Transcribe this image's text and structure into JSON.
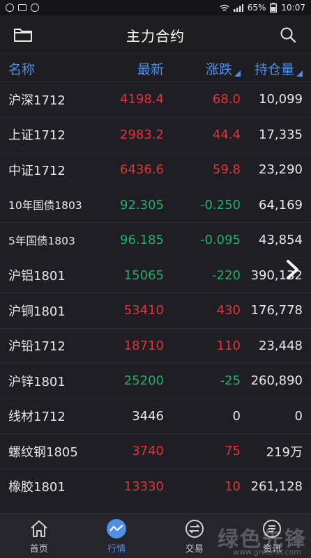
{
  "status_bar": {
    "battery": "65%",
    "time": "10:07"
  },
  "header": {
    "title": "主力合约"
  },
  "columns": {
    "name": "名称",
    "price": "最新",
    "change": "涨跌",
    "open_interest": "持仓量"
  },
  "rows": [
    {
      "name": "沪深1712",
      "price": "4198.4",
      "change": "68.0",
      "oi": "10,099",
      "dir": "up"
    },
    {
      "name": "上证1712",
      "price": "2983.2",
      "change": "44.4",
      "oi": "17,335",
      "dir": "up"
    },
    {
      "name": "中证1712",
      "price": "6436.6",
      "change": "59.8",
      "oi": "23,290",
      "dir": "up"
    },
    {
      "name": "10年国债1803",
      "price": "92.305",
      "change": "-0.250",
      "oi": "64,169",
      "dir": "down"
    },
    {
      "name": "5年国债1803",
      "price": "96.185",
      "change": "-0.095",
      "oi": "43,854",
      "dir": "down"
    },
    {
      "name": "沪铝1801",
      "price": "15065",
      "change": "-220",
      "oi": "390,1​32",
      "dir": "down"
    },
    {
      "name": "沪铜1801",
      "price": "53410",
      "change": "430",
      "oi": "176,778",
      "dir": "up"
    },
    {
      "name": "沪铅1712",
      "price": "18710",
      "change": "110",
      "oi": "23,448",
      "dir": "up"
    },
    {
      "name": "沪锌1801",
      "price": "25200",
      "change": "-25",
      "oi": "260,890",
      "dir": "down"
    },
    {
      "name": "线材1712",
      "price": "3446",
      "change": "0",
      "oi": "0",
      "dir": "flat"
    },
    {
      "name": "螺纹钢1805",
      "price": "3740",
      "change": "75",
      "oi": "219万",
      "dir": "up"
    },
    {
      "name": "橡胶1801",
      "price": "13330",
      "change": "10",
      "oi": "261,128",
      "dir": "up"
    }
  ],
  "nav": [
    {
      "label": "首页",
      "icon": "home-icon"
    },
    {
      "label": "行情",
      "icon": "chart-icon"
    },
    {
      "label": "交易",
      "icon": "trade-icon"
    },
    {
      "label": "资讯",
      "icon": "news-icon"
    }
  ],
  "watermark": {
    "text": "绿色先锋",
    "url": "www.greenxf.com"
  },
  "colors": {
    "accent": "#4f8fe6",
    "up": "#e0343a",
    "down": "#22b066",
    "background": "#1e1e24"
  }
}
